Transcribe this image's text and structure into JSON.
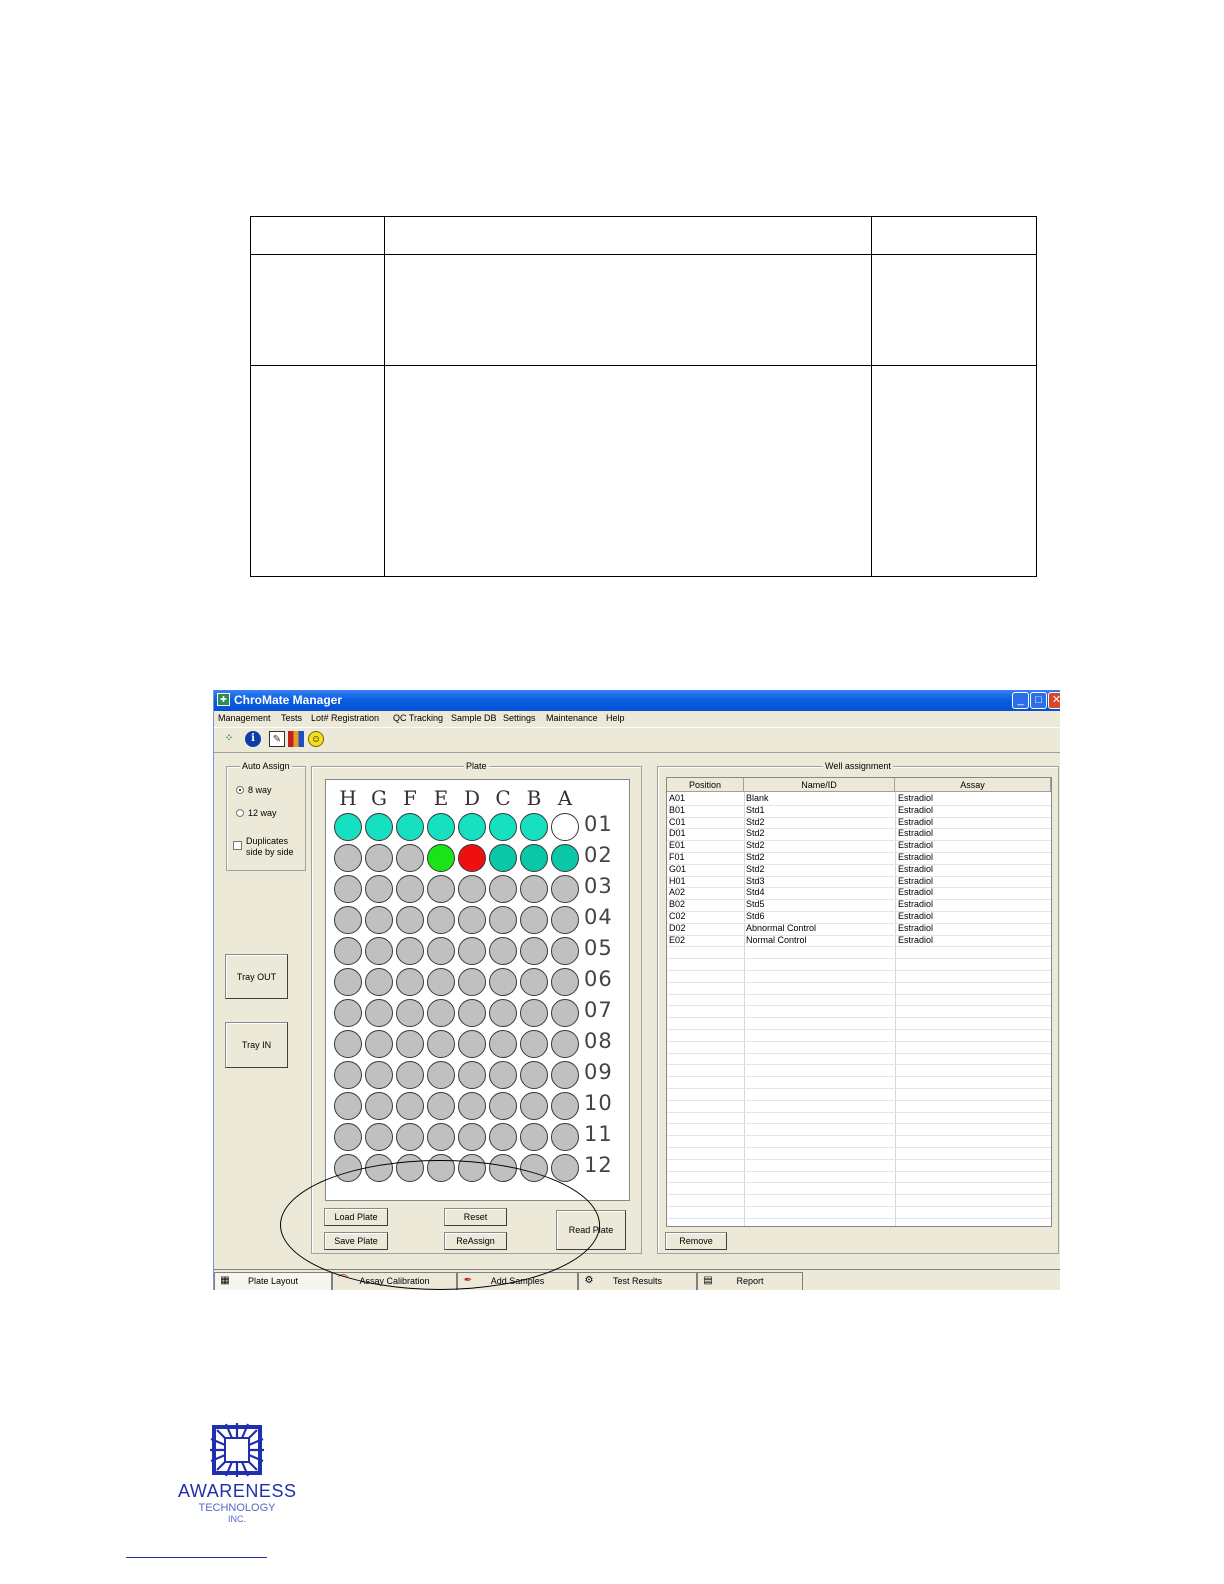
{
  "window": {
    "title": "ChroMate Manager"
  },
  "menu": [
    "Management",
    "Tests",
    "Lot# Registration",
    "QC Tracking",
    "Sample DB",
    "Settings",
    "Maintenance",
    "Help"
  ],
  "toolbar_icons": [
    "connect-icon",
    "info-icon",
    "edit-icon",
    "book-icon",
    "smiley-icon"
  ],
  "auto_assign": {
    "title": "Auto Assign",
    "option_8way": "8 way",
    "option_12way": "12 way",
    "selected": "8 way",
    "duplicates_line1": "Duplicates",
    "duplicates_line2": "side by side",
    "duplicates_checked": false
  },
  "tray": {
    "out_label": "Tray OUT",
    "in_label": "Tray IN"
  },
  "plate": {
    "title": "Plate",
    "columns": [
      "H",
      "G",
      "F",
      "E",
      "D",
      "C",
      "B",
      "A"
    ],
    "rows": [
      "01",
      "02",
      "03",
      "04",
      "05",
      "06",
      "07",
      "08",
      "09",
      "10",
      "11",
      "12"
    ],
    "colors": {
      "empty": "#c0c0c0",
      "blank": "#ffffff",
      "standard": "#17e0c0",
      "control": "#0ac7a8",
      "green": "#18e418",
      "red": "#ee1010"
    },
    "wells": {
      "A01": "blank",
      "B01": "standard",
      "C01": "standard",
      "D01": "standard",
      "E01": "standard",
      "F01": "standard",
      "G01": "standard",
      "H01": "standard",
      "A02": "control",
      "B02": "control",
      "C02": "control",
      "D02": "red",
      "E02": "green"
    }
  },
  "plate_buttons": {
    "load": "Load Plate",
    "save": "Save Plate",
    "reset": "Reset",
    "reassign": "ReAssign",
    "read": "Read Plate"
  },
  "well_assignment": {
    "title": "Well assignment",
    "headers": [
      "Position",
      "Name/ID",
      "Assay"
    ],
    "rows": [
      [
        "A01",
        "Blank",
        "Estradiol"
      ],
      [
        "B01",
        "Std1",
        "Estradiol"
      ],
      [
        "C01",
        "Std2",
        "Estradiol"
      ],
      [
        "D01",
        "Std2",
        "Estradiol"
      ],
      [
        "E01",
        "Std2",
        "Estradiol"
      ],
      [
        "F01",
        "Std2",
        "Estradiol"
      ],
      [
        "G01",
        "Std2",
        "Estradiol"
      ],
      [
        "H01",
        "Std3",
        "Estradiol"
      ],
      [
        "A02",
        "Std4",
        "Estradiol"
      ],
      [
        "B02",
        "Std5",
        "Estradiol"
      ],
      [
        "C02",
        "Std6",
        "Estradiol"
      ],
      [
        "D02",
        "Abnormal Control",
        "Estradiol"
      ],
      [
        "E02",
        "Normal Control",
        "Estradiol"
      ]
    ],
    "remove_label": "Remove"
  },
  "tabs": [
    "Plate Layout",
    "Assay Calibration",
    "Add Samples",
    "Test Results",
    "Report"
  ],
  "active_tab": "Plate Layout",
  "logo": {
    "line1": "AWARENESS",
    "line2": "TECHNOLOGY",
    "line3": "INC."
  }
}
